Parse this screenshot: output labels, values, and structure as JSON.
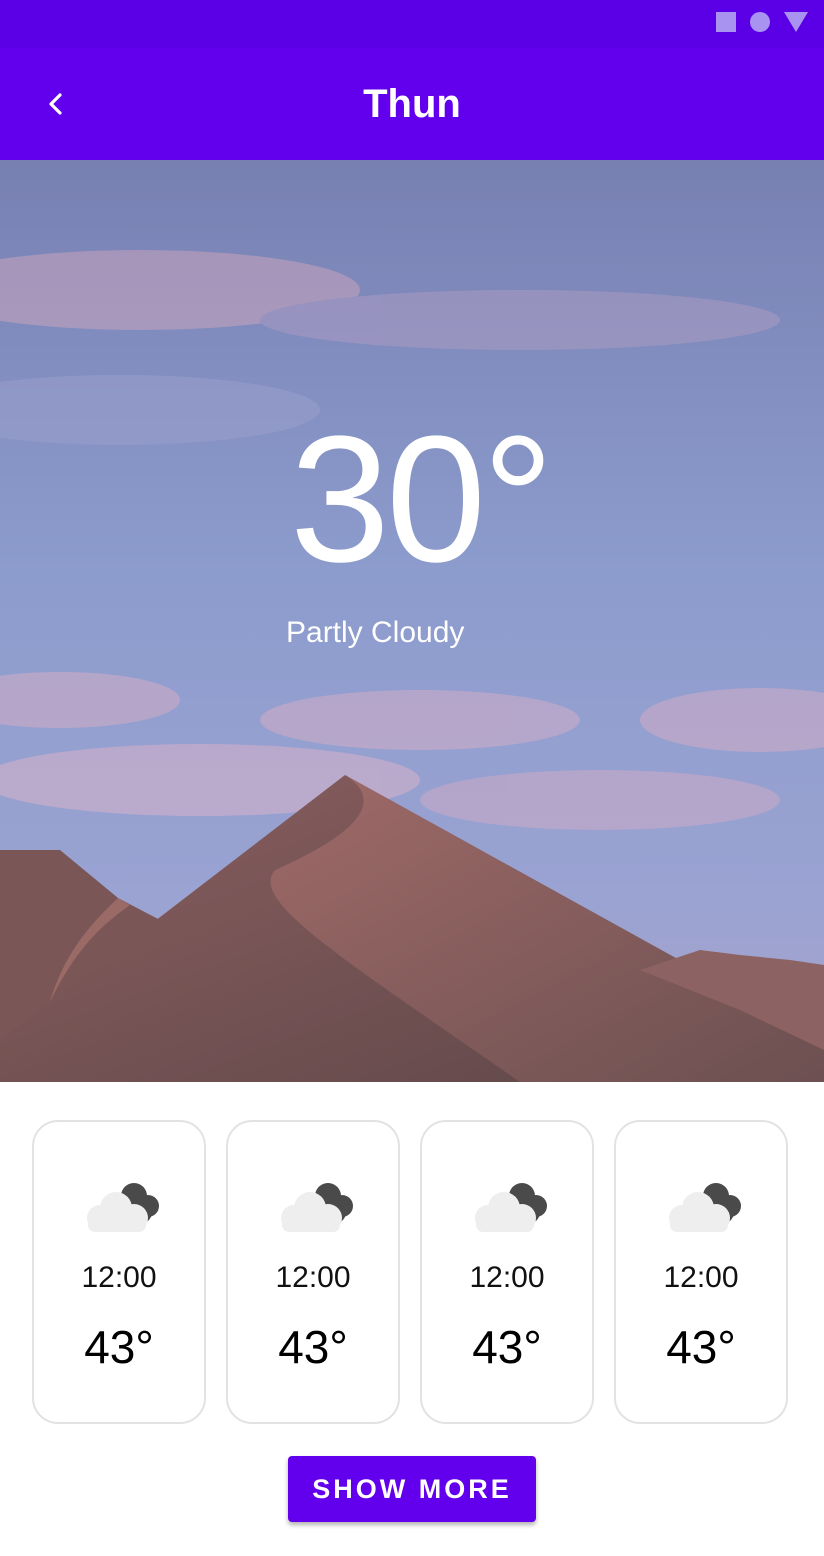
{
  "status_bar": {
    "icons": [
      "square-icon",
      "circle-icon",
      "triangle-icon"
    ]
  },
  "app_bar": {
    "title": "Thun",
    "back_icon": "chevron-left-icon"
  },
  "current": {
    "temperature": "30°",
    "condition": "Partly Cloudy"
  },
  "forecast": [
    {
      "time": "12:00",
      "temperature": "43°",
      "icon": "partly-cloudy-night-icon"
    },
    {
      "time": "12:00",
      "temperature": "43°",
      "icon": "partly-cloudy-night-icon"
    },
    {
      "time": "12:00",
      "temperature": "43°",
      "icon": "partly-cloudy-night-icon"
    },
    {
      "time": "12:00",
      "temperature": "43°",
      "icon": "partly-cloudy-night-icon"
    }
  ],
  "actions": {
    "show_more_label": "SHOW MORE"
  },
  "colors": {
    "primary": "#6200ee",
    "status_bar": "#5b00e6",
    "card_border": "#e2e2e2"
  }
}
